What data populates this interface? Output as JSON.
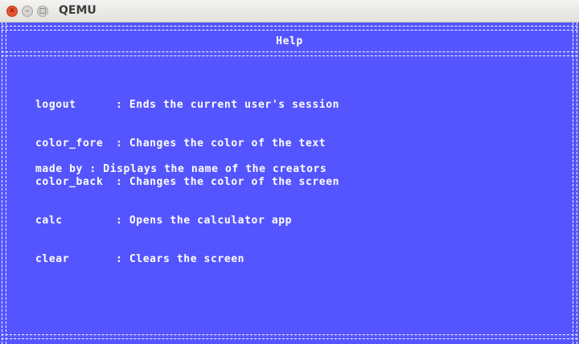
{
  "window": {
    "title": "QEMU",
    "close_icon": "close-icon",
    "minimize_icon": "minimize-icon",
    "maximize_icon": "maximize-icon"
  },
  "screen": {
    "background_color": "#5555ff",
    "text_color": "#ffffff",
    "heading": "Help",
    "commands": [
      {
        "name": "logout",
        "description": ": Ends the current user's session"
      },
      {
        "name": "color_fore",
        "description": ": Changes the color of the text"
      },
      {
        "name": "color_back",
        "description": ": Changes the color of the screen"
      },
      {
        "name": "calc",
        "description": ": Opens the calculator app"
      },
      {
        "name": "clear",
        "description": ": Clears the screen"
      }
    ],
    "credits": "made by : Displays the name of the creators"
  }
}
